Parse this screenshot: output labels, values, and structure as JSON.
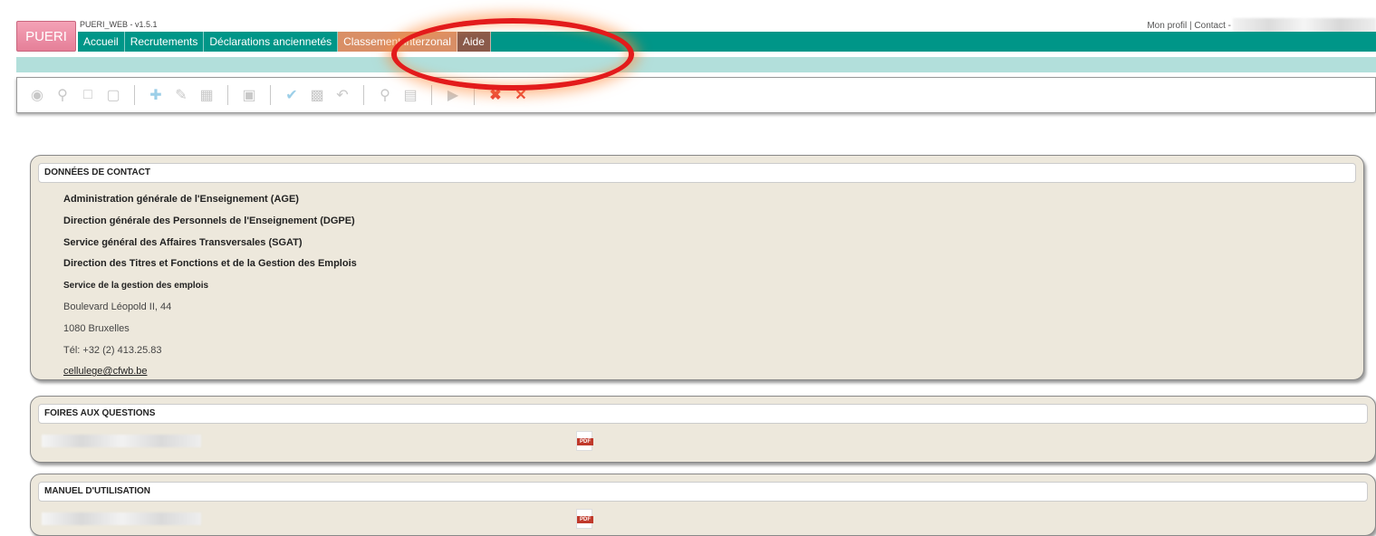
{
  "header": {
    "logo": "PUERI",
    "version": "PUERI_WEB - v1.5.1",
    "profile_link": "Mon profil",
    "contact_link": "Contact -",
    "separator": "|"
  },
  "nav": [
    {
      "label": "Accueil"
    },
    {
      "label": "Recrutements"
    },
    {
      "label": "Déclarations anciennetés"
    },
    {
      "label": "Classement interzonal"
    },
    {
      "label": "Aide"
    }
  ],
  "toolbar": {
    "icons": [
      "binoculars-icon",
      "search-doc-icon",
      "new-doc-icon",
      "page-icon",
      "add-icon",
      "edit-icon",
      "copy-icon",
      "delete-icon",
      "check-icon",
      "save-icon",
      "undo-icon",
      "search-icon",
      "print-icon",
      "next-icon",
      "close-all-icon",
      "close-icon"
    ]
  },
  "contact": {
    "title": "DONNÉES DE CONTACT",
    "lines": [
      "Administration générale de l'Enseignement (AGE)",
      "Direction générale des Personnels de l'Enseignement (DGPE)",
      "Service général des Affaires Transversales (SGAT)",
      "Direction des Titres et Fonctions et de la Gestion des Emplois",
      "Service de la gestion des emplois",
      "Boulevard Léopold II, 44",
      "1080 Bruxelles",
      "Tél: +32 (2) 413.25.83"
    ],
    "email": "cellulege@cfwb.be"
  },
  "faq": {
    "title": "FOIRES AUX QUESTIONS",
    "pdf_label": "PDF"
  },
  "manuel": {
    "title": "MANUEL D'UTILISATION",
    "pdf_label": "PDF"
  },
  "colors": {
    "nav_bg": "#009688",
    "subbar_bg": "#b2dfdb",
    "panel_bg": "#ede8dc",
    "highlight": "#e31b1b"
  }
}
